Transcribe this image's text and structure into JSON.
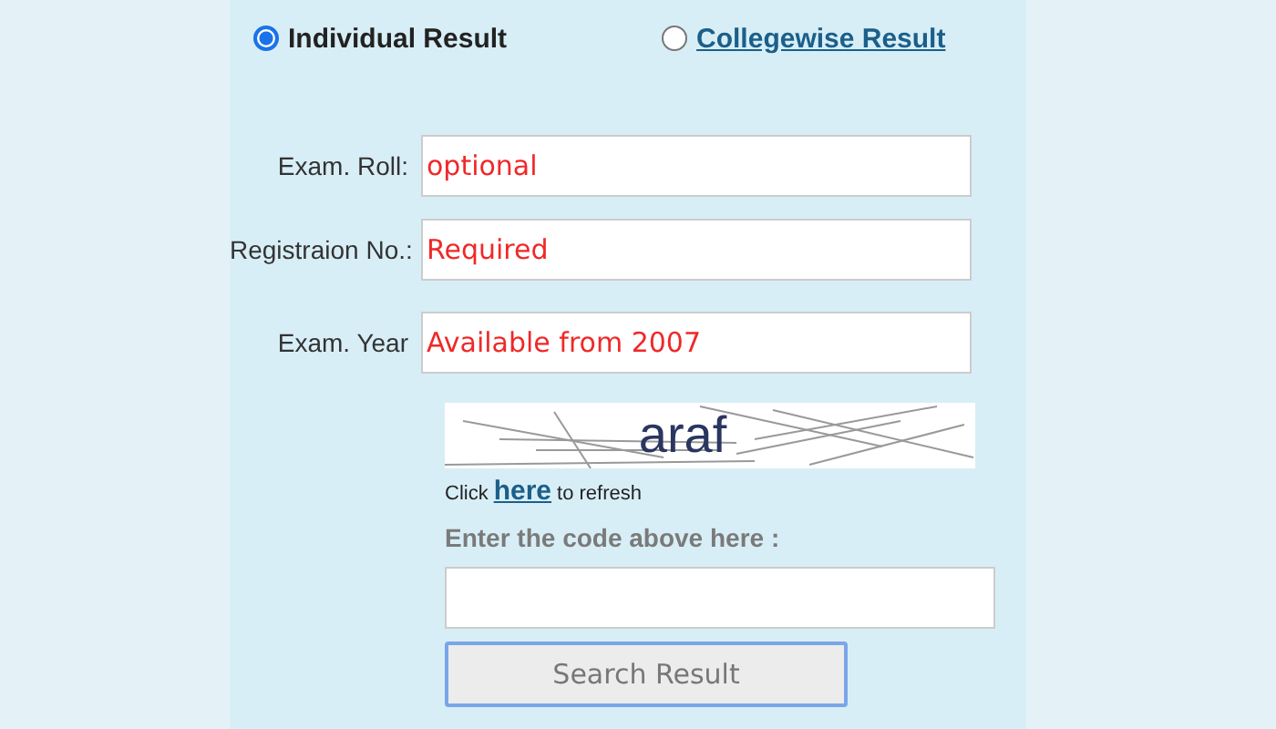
{
  "result_type": [
    {
      "label": "Individual Result",
      "selected": true,
      "kind": "plain"
    },
    {
      "label": "Collegewise Result",
      "selected": false,
      "kind": "link"
    }
  ],
  "fields": [
    {
      "label": "Exam. Roll:",
      "placeholder": "optional"
    },
    {
      "label": "Registraion No.:",
      "placeholder": "Required"
    },
    {
      "label": "Exam. Year",
      "placeholder": "Available from 2007"
    }
  ],
  "captcha": {
    "code": "araf",
    "refresh_before": "Click",
    "refresh_link": "here",
    "refresh_after": "to refresh"
  },
  "code_prompt": "Enter the code above here :",
  "submit": "Search Result"
}
